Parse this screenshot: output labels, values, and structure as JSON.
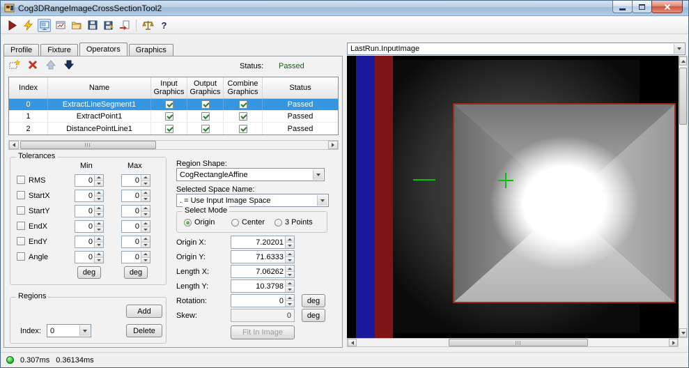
{
  "window": {
    "title": "Cog3DRangeImageCrossSectionTool2"
  },
  "toolbar": {
    "icons": [
      "run",
      "run-electric",
      "floating-tool-display",
      "results-display",
      "open-file",
      "save-file",
      "save-image",
      "import",
      "benchmark",
      "help"
    ]
  },
  "tabs": [
    "Profile",
    "Fixture",
    "Operators",
    "Graphics"
  ],
  "operators": {
    "status_label": "Status:",
    "status_value": "Passed",
    "table": {
      "headers": [
        "Index",
        "Name",
        "Input Graphics",
        "Output Graphics",
        "Combine Graphics",
        "Status"
      ],
      "rows": [
        {
          "index": "0",
          "name": "ExtractLineSegment1",
          "input": true,
          "output": true,
          "combine": true,
          "status": "Passed"
        },
        {
          "index": "1",
          "name": "ExtractPoint1",
          "input": true,
          "output": true,
          "combine": true,
          "status": "Passed"
        },
        {
          "index": "2",
          "name": "DistancePointLine1",
          "input": true,
          "output": true,
          "combine": true,
          "status": "Passed"
        }
      ]
    }
  },
  "tolerances": {
    "title": "Tolerances",
    "min_header": "Min",
    "max_header": "Max",
    "deg_label": "deg",
    "rows": [
      {
        "label": "RMS",
        "min": "0",
        "max": "0"
      },
      {
        "label": "StartX",
        "min": "0",
        "max": "0"
      },
      {
        "label": "StartY",
        "min": "0",
        "max": "0"
      },
      {
        "label": "EndX",
        "min": "0",
        "max": "0"
      },
      {
        "label": "EndY",
        "min": "0",
        "max": "0"
      },
      {
        "label": "Angle",
        "min": "0",
        "max": "0"
      }
    ]
  },
  "region": {
    "shape_label": "Region Shape:",
    "shape_value": "CogRectangleAffine",
    "space_label": "Selected Space Name:",
    "space_value": ". = Use Input Image Space",
    "select_mode": {
      "title": "Select Mode",
      "options": [
        "Origin",
        "Center",
        "3 Points"
      ],
      "selected": "Origin"
    },
    "origin_x": {
      "label": "Origin X:",
      "value": "7.20201"
    },
    "origin_y": {
      "label": "Origin Y:",
      "value": "71.6333"
    },
    "length_x": {
      "label": "Length X:",
      "value": "7.06262"
    },
    "length_y": {
      "label": "Length Y:",
      "value": "10.3798"
    },
    "rotation": {
      "label": "Rotation:",
      "value": "0"
    },
    "skew": {
      "label": "Skew:",
      "value": "0"
    },
    "deg_label": "deg",
    "fit_button_label": "Fit In Image"
  },
  "regions": {
    "title": "Regions",
    "index_label": "Index:",
    "index_value": "0",
    "add_label": "Add",
    "delete_label": "Delete"
  },
  "image_panel": {
    "selector": "LastRun.InputImage"
  },
  "status_bar": {
    "time1": "0.307ms",
    "time2": "0.36134ms"
  },
  "colors": {
    "selection_blue": "#3696e0",
    "passed_green": "#146014",
    "stripe_blue": "#1a1a9a",
    "stripe_red": "#7f1414",
    "marker_green": "#00c400",
    "region_outline_red": "#a12a1b"
  }
}
